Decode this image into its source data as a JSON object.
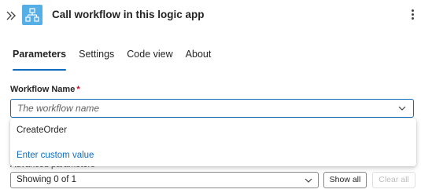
{
  "header": {
    "title": "Call workflow in this logic app",
    "collapse_icon": "chevron-double-right-icon",
    "app_icon": "workflow-icon",
    "app_icon_color": "#56aee6",
    "more_icon": "more-vertical-icon"
  },
  "tabs": [
    {
      "label": "Parameters",
      "active": true
    },
    {
      "label": "Settings",
      "active": false
    },
    {
      "label": "Code view",
      "active": false
    },
    {
      "label": "About",
      "active": false
    }
  ],
  "workflow_field": {
    "label": "Workflow Name",
    "required_mark": "*",
    "value": "",
    "placeholder": "The workflow name",
    "options": [
      "CreateOrder"
    ],
    "custom_option_label": "Enter custom value"
  },
  "advanced": {
    "label": "Advanced parameters",
    "select_value": "Showing 0 of 1",
    "show_all_label": "Show all",
    "clear_all_label": "Clear all"
  },
  "colors": {
    "accent": "#0f6cbd",
    "required": "#c50f1f"
  }
}
